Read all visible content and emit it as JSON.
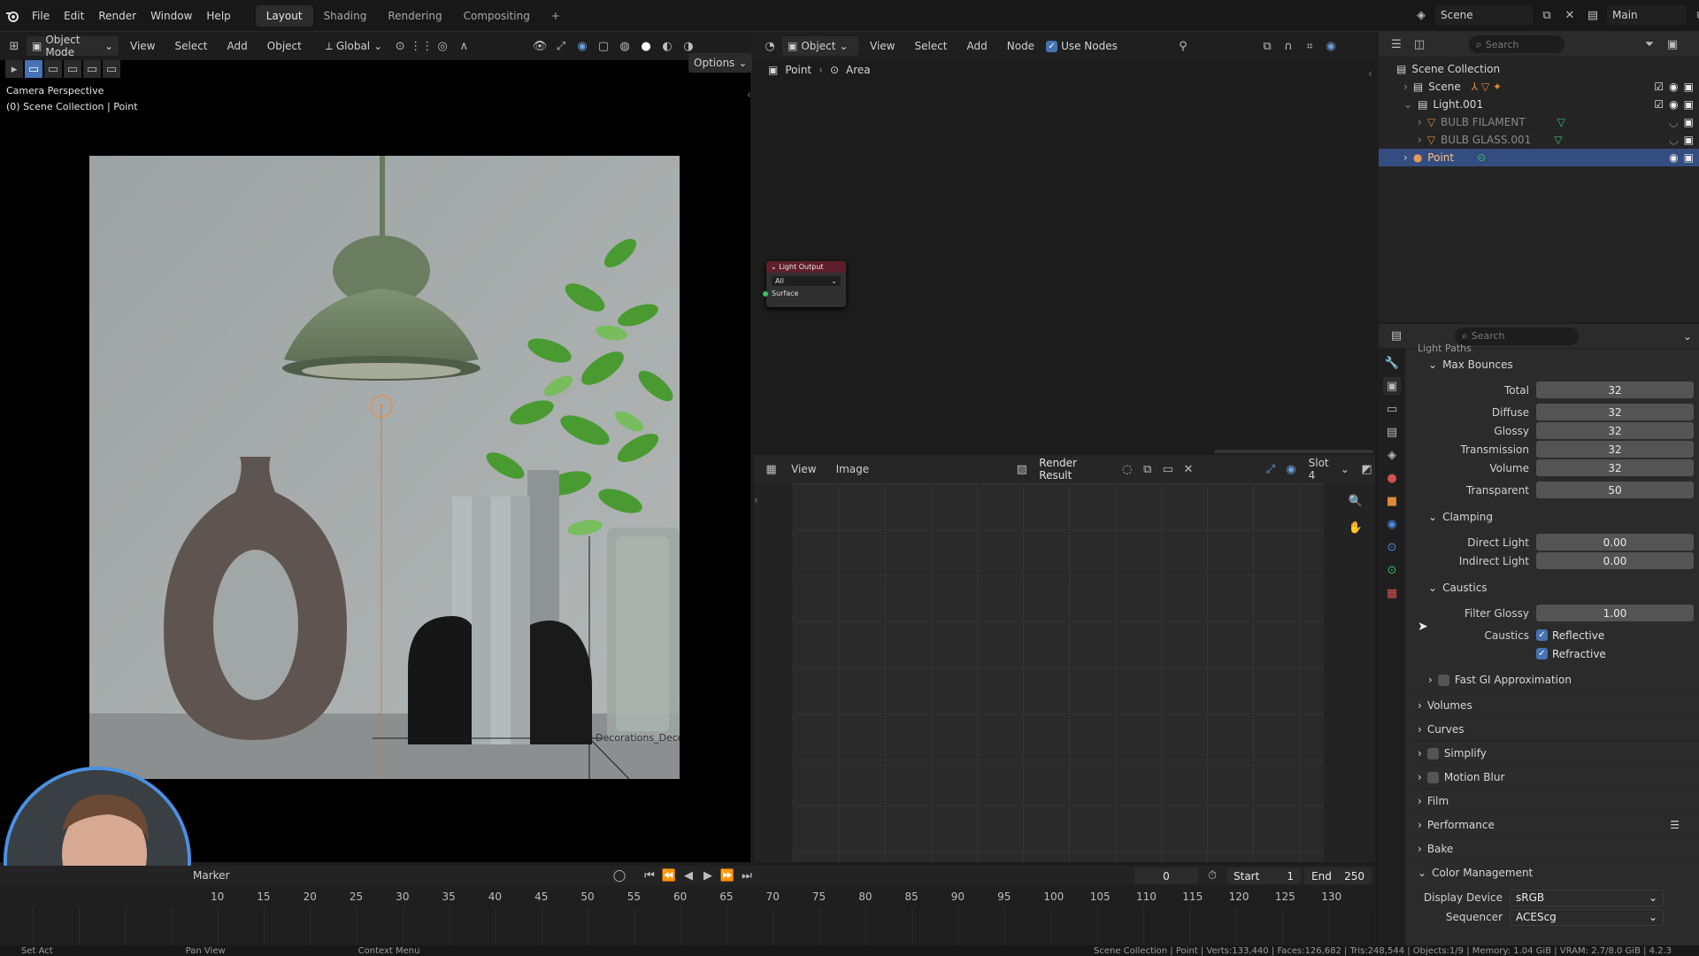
{
  "topbar": {
    "menus": [
      "File",
      "Edit",
      "Render",
      "Window",
      "Help"
    ],
    "workspaces": [
      "Layout",
      "Shading",
      "Rendering",
      "Compositing"
    ],
    "add_tab": "+",
    "scene": "Scene",
    "view_layer": "Main"
  },
  "viewport": {
    "mode": "Object Mode",
    "menus": [
      "View",
      "Select",
      "Add",
      "Object"
    ],
    "transform": "Global",
    "options": "Options",
    "overlay_title": "Camera Perspective",
    "overlay_sub": "(0) Scene Collection | Point",
    "object_label": "Decorations_Deco"
  },
  "node_editor": {
    "type": "Object",
    "menus": [
      "View",
      "Select",
      "Add",
      "Node"
    ],
    "use_nodes": "Use Nodes",
    "breadcrumb": [
      "Point",
      "Area"
    ],
    "node": {
      "title": "Light Output",
      "target": "All",
      "socket": "Surface"
    }
  },
  "image_editor": {
    "menus": [
      "View",
      "Image"
    ],
    "image": "Render Result",
    "slot": "Slot 4"
  },
  "outliner": {
    "search_placeholder": "Search",
    "root": "Scene Collection",
    "items": [
      {
        "name": "Scene",
        "indent": 1
      },
      {
        "name": "Light.001",
        "indent": 1
      },
      {
        "name": "BULB FILAMENT",
        "indent": 2
      },
      {
        "name": "BULB GLASS.001",
        "indent": 2
      },
      {
        "name": "Point",
        "indent": 1
      }
    ]
  },
  "properties": {
    "search_placeholder": "Search",
    "light_paths": "Light Paths",
    "max_bounces": "Max Bounces",
    "bounces": [
      {
        "label": "Total",
        "value": "32"
      },
      {
        "label": "Diffuse",
        "value": "32"
      },
      {
        "label": "Glossy",
        "value": "32"
      },
      {
        "label": "Transmission",
        "value": "32"
      },
      {
        "label": "Volume",
        "value": "32"
      },
      {
        "label": "Transparent",
        "value": "50"
      }
    ],
    "clamping": "Clamping",
    "clamp": [
      {
        "label": "Direct Light",
        "value": "0.00"
      },
      {
        "label": "Indirect Light",
        "value": "0.00"
      }
    ],
    "caustics_section": "Caustics",
    "filter_glossy_label": "Filter Glossy",
    "filter_glossy": "1.00",
    "caustics_label": "Caustics",
    "reflective": "Reflective",
    "refractive": "Refractive",
    "fast_gi": "Fast GI Approximation",
    "panels": [
      "Volumes",
      "Curves",
      "Simplify",
      "Motion Blur",
      "Film",
      "Performance",
      "Bake"
    ],
    "color_management": "Color Management",
    "display_device_label": "Display Device",
    "display_device": "sRGB",
    "sequencer_label": "Sequencer",
    "sequencer": "ACEScg"
  },
  "timeline": {
    "marker": "Marker",
    "current_frame": "0",
    "start_label": "Start",
    "start": "1",
    "end_label": "End",
    "end": "250",
    "ticks": [
      "10",
      "15",
      "20",
      "25",
      "30",
      "35",
      "40",
      "45",
      "50",
      "55",
      "60",
      "65",
      "70",
      "75",
      "80",
      "85",
      "90",
      "95",
      "100",
      "105",
      "110",
      "115",
      "120",
      "125",
      "130"
    ]
  },
  "status": {
    "left": [
      "Set Act",
      "Pan View",
      "Context Menu"
    ],
    "right": "Scene Collection | Point | Verts:133,440 | Faces:126,682 | Tris:248,544 | Objects:1/9 | Memory: 1.04 GiB | VRAM: 2.7/8.0 GiB | 4.2.3"
  },
  "colors": {
    "accent": "#4772b3",
    "selected_row": "#334d80",
    "node_header": "#5e1f2a"
  }
}
